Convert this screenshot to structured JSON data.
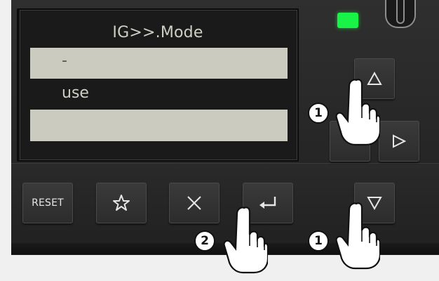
{
  "display": {
    "title": "IG>>.Mode",
    "options": [
      "-",
      "use"
    ],
    "selected_index": 0
  },
  "buttons": {
    "reset_label": "RESET",
    "favorite_icon": "star-icon",
    "cancel_icon": "close-icon",
    "enter_icon": "enter-icon",
    "up_icon": "triangle-up-icon",
    "down_icon": "triangle-down-icon",
    "right_icon": "triangle-right-icon"
  },
  "indicators": {
    "led_color": "#19f247"
  },
  "callouts": [
    {
      "number": "1",
      "target": "up-button"
    },
    {
      "number": "2",
      "target": "enter-button"
    },
    {
      "number": "1",
      "target": "down-button"
    }
  ],
  "colors": {
    "panel": "#2a2a2a",
    "lcd_highlight": "#cbcbbf",
    "lcd_text": "#cfcfc4",
    "lcd_text_dark": "#555555"
  }
}
